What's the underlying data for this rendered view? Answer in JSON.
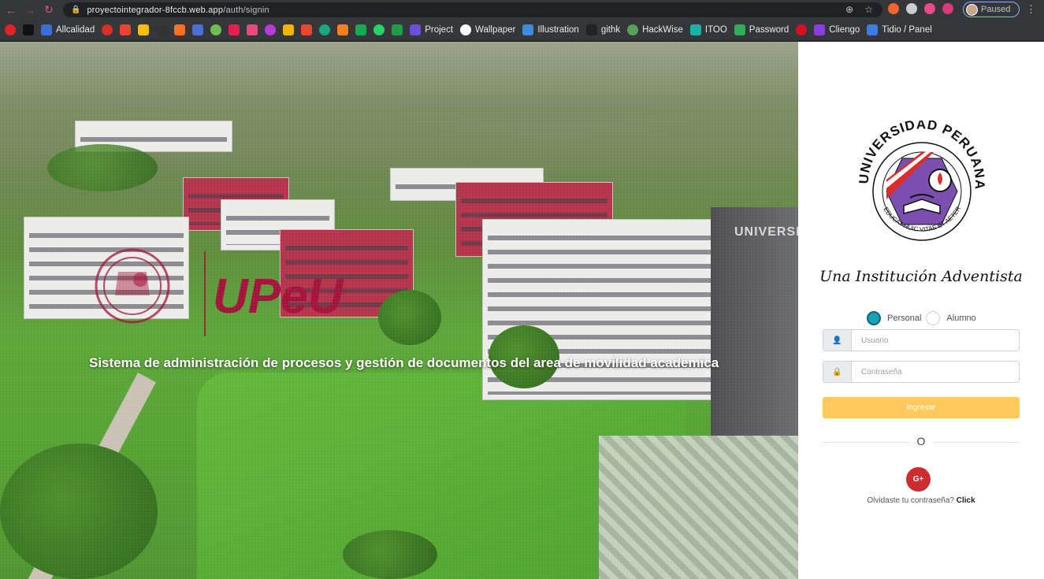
{
  "browser": {
    "url_host": "proyectointegrador-8fccb.web.app",
    "url_path": "/auth/signin",
    "profile_status": "Paused",
    "bookmarks": [
      {
        "label": "",
        "color": "#e02424",
        "icon": "youtube-icon"
      },
      {
        "label": "",
        "color": "#111111",
        "icon": "play-icon"
      },
      {
        "label": "Allcalidad",
        "color": "#3b6fd6",
        "icon": "allcalidad-icon"
      },
      {
        "label": "",
        "color": "#d93025",
        "icon": "location-icon"
      },
      {
        "label": "",
        "color": "#ea4335",
        "icon": "gmail-icon"
      },
      {
        "label": "",
        "color": "#fbbc04",
        "icon": "drive-icon"
      },
      {
        "label": "",
        "color": "#333333",
        "icon": "github-icon"
      },
      {
        "label": "",
        "color": "#fc6d26",
        "icon": "gitlab-icon"
      },
      {
        "label": "",
        "color": "#4a6fd6",
        "icon": "translate-icon"
      },
      {
        "label": "",
        "color": "#6cc04a",
        "icon": "bookmark-icon"
      },
      {
        "label": "",
        "color": "#e61e4d",
        "icon": "bookmark-icon"
      },
      {
        "label": "",
        "color": "#e84a7a",
        "icon": "bookmark-icon"
      },
      {
        "label": "",
        "color": "#b73bd6",
        "icon": "bookmark-icon"
      },
      {
        "label": "",
        "color": "#f4b400",
        "icon": "bookmark-icon"
      },
      {
        "label": "",
        "color": "#e8472c",
        "icon": "bookmark-icon"
      },
      {
        "label": "",
        "color": "#1ba784",
        "icon": "bookmark-icon"
      },
      {
        "label": "",
        "color": "#f4801f",
        "icon": "bookmark-icon"
      },
      {
        "label": "",
        "color": "#13aa52",
        "icon": "mongodb-icon"
      },
      {
        "label": "",
        "color": "#25d366",
        "icon": "whatsapp-icon"
      },
      {
        "label": "",
        "color": "#1e9e4a",
        "icon": "shield-icon"
      },
      {
        "label": "Project",
        "color": "#6b4fd8",
        "icon": "project-icon"
      },
      {
        "label": "Wallpaper",
        "color": "#ffffff",
        "icon": "wallpaper-icon"
      },
      {
        "label": "Illustration",
        "color": "#3d8be0",
        "icon": "illustration-icon"
      },
      {
        "label": "githk",
        "color": "#222222",
        "icon": "github-icon"
      },
      {
        "label": "HackWise",
        "color": "#5aa05a",
        "icon": "hackwise-icon"
      },
      {
        "label": "ITOO",
        "color": "#19b3a6",
        "icon": "itoo-icon"
      },
      {
        "label": "Password",
        "color": "#2fae5a",
        "icon": "password-icon"
      },
      {
        "label": "",
        "color": "#d91023",
        "icon": "peru-flag-icon"
      },
      {
        "label": "Cliengo",
        "color": "#8a3de0",
        "icon": "cliengo-icon"
      },
      {
        "label": "Tidio / Panel",
        "color": "#3d7de0",
        "icon": "tidio-icon"
      }
    ]
  },
  "hero": {
    "title": "Sistema de administración de procesos y gestión de documentos del area de movilidad academica",
    "logo_text": "UPeU",
    "building_sign": "UNIVERSI"
  },
  "login": {
    "tagline": "Una Institución Adventista",
    "radio_personal": "Personal",
    "radio_alumno": "Alumno",
    "user_placeholder": "Usuario",
    "password_placeholder": "Contraseña",
    "login_button": "Ingresar",
    "divider": "O",
    "google_label": "G+",
    "forgot_text": "Olvidaste tu contraseña?",
    "forgot_link": "Click"
  },
  "colors": {
    "login_button": "#ffc95c",
    "radio_active": "#17a2b8",
    "google_button": "#cf2d2d",
    "brand": "#a3123a"
  }
}
